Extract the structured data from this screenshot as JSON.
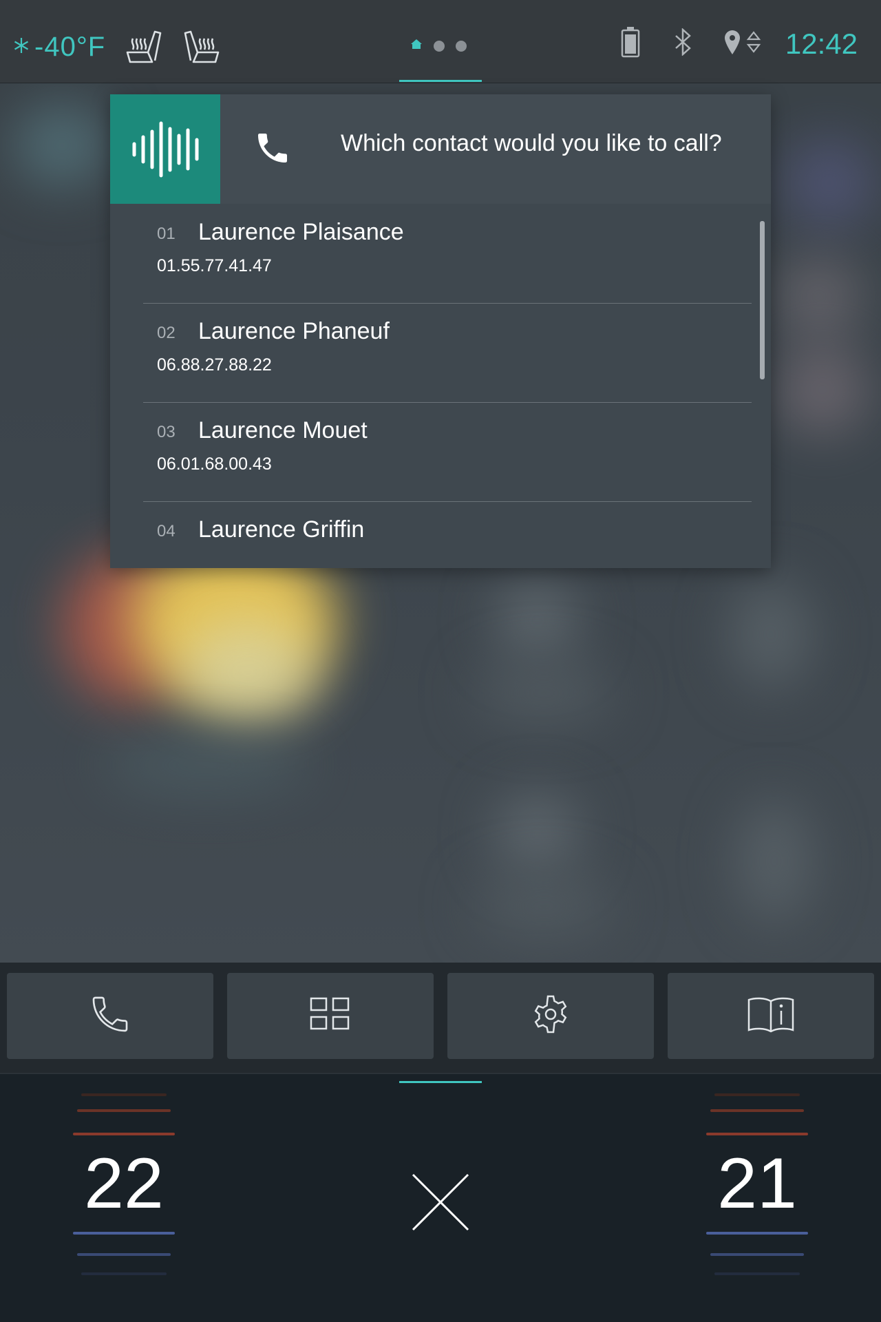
{
  "status_bar": {
    "outside_temp": "-40°F",
    "clock": "12:42",
    "icons": [
      "snowflake-icon",
      "heated-seat-left-icon",
      "heated-seat-right-icon",
      "home-icon",
      "battery-icon",
      "bluetooth-icon",
      "location-icon"
    ]
  },
  "voice_dialog": {
    "prompt": "Which contact would you like to call?",
    "contacts": [
      {
        "num": "01",
        "name": "Laurence Plaisance",
        "phone": "01.55.77.41.47"
      },
      {
        "num": "02",
        "name": "Laurence Phaneuf",
        "phone": "06.88.27.88.22"
      },
      {
        "num": "03",
        "name": "Laurence Mouet",
        "phone": "06.01.68.00.43"
      },
      {
        "num": "04",
        "name": "Laurence Griffin",
        "phone": ""
      }
    ]
  },
  "dock": {
    "buttons": [
      "phone-icon",
      "apps-grid-icon",
      "settings-gear-icon",
      "manual-info-icon"
    ]
  },
  "climate": {
    "left_temp": "22",
    "right_temp": "21",
    "colors": {
      "heat": "#8a3a2c",
      "cool": "#4a5f9a",
      "accent": "#40c6c0"
    }
  }
}
